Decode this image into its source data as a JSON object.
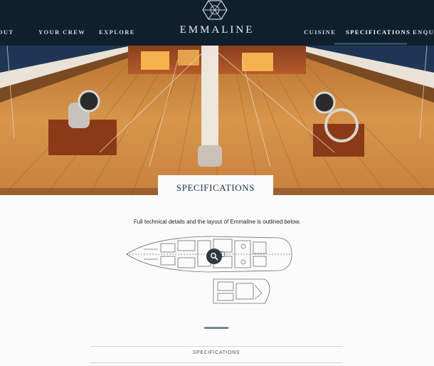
{
  "header": {
    "brand": "EMMALINE",
    "logo_icon": "compass-rose-icon",
    "nav_left": [
      {
        "label": "ABOUT",
        "clipped_text": "OUT"
      },
      {
        "label": "YOUR CREW"
      },
      {
        "label": "EXPLORE"
      }
    ],
    "nav_right": [
      {
        "label": "CUISINE"
      },
      {
        "label": "SPECIFICATIONS",
        "active": true
      },
      {
        "label": "ENQUIRE",
        "clipped_text": "ENQUIR"
      }
    ],
    "bg_color": "#0f1f2c"
  },
  "hero": {
    "image": "yacht-deck-photo"
  },
  "main": {
    "section_title": "SPECIFICATIONS",
    "intro": "Full technical details and the layout of Emmaline is outlined below.",
    "plans_image": "deck-plan-drawing",
    "zoom_icon": "search-icon"
  },
  "accordion": {
    "label": "SPECIFICATIONS"
  }
}
